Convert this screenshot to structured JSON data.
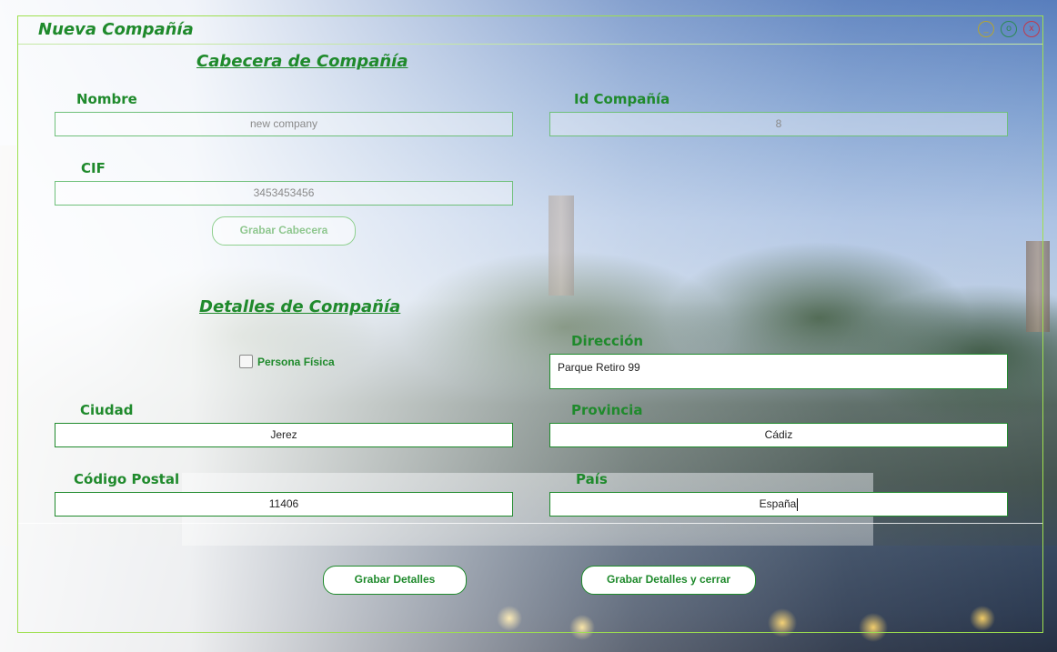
{
  "window": {
    "title": "Nueva Compañía",
    "controls": {
      "minimize": "_",
      "maximize": "o",
      "close": "x"
    }
  },
  "header_section": {
    "title": "Cabecera de Compañía",
    "nombre": {
      "label": "Nombre",
      "value": "new company"
    },
    "id_compania": {
      "label": "Id Compañía",
      "value": "8"
    },
    "cif": {
      "label": "CIF",
      "value": "3453453456"
    },
    "save_button": "Grabar Cabecera"
  },
  "details_section": {
    "title": "Detalles de Compañía",
    "persona_fisica": {
      "label": "Persona Física",
      "checked": false
    },
    "direccion": {
      "label": "Dirección",
      "value": "Parque Retiro 99"
    },
    "ciudad": {
      "label": "Ciudad",
      "value": "Jerez"
    },
    "provincia": {
      "label": "Provincia",
      "value": "Cádiz"
    },
    "codigo_postal": {
      "label": "Código Postal",
      "value": "11406"
    },
    "pais": {
      "label": "País",
      "value": "España"
    }
  },
  "buttons": {
    "save_details": "Grabar Detalles",
    "save_details_close": "Grabar Detalles y cerrar"
  },
  "colors": {
    "accent": "#1f8a2c",
    "frame": "#9ee04f"
  }
}
